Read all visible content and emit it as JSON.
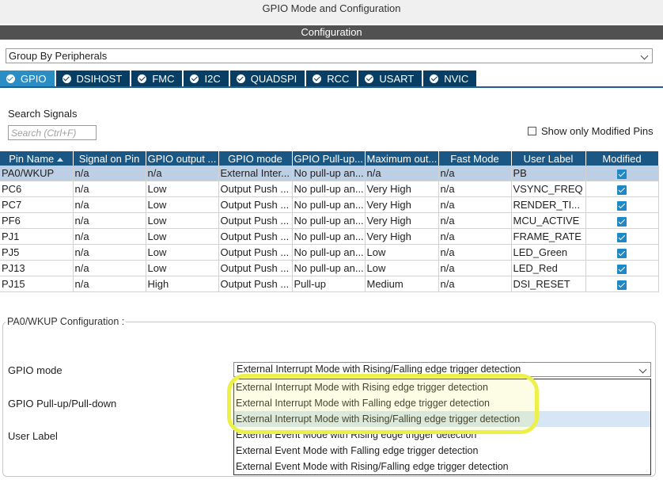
{
  "window": {
    "title": "GPIO Mode and Configuration"
  },
  "section": {
    "title": "Configuration"
  },
  "group_by": {
    "value": "Group By Peripherals"
  },
  "tabs": [
    {
      "label": "GPIO",
      "active": true
    },
    {
      "label": "DSIHOST"
    },
    {
      "label": "FMC"
    },
    {
      "label": "I2C"
    },
    {
      "label": "QUADSPI"
    },
    {
      "label": "RCC"
    },
    {
      "label": "USART"
    },
    {
      "label": "NVIC"
    }
  ],
  "search": {
    "label": "Search Signals",
    "placeholder": "Search (Ctrl+F)"
  },
  "show_modified": {
    "label": "Show only Modified Pins"
  },
  "table": {
    "headers": [
      "Pin Name",
      "Signal on Pin",
      "GPIO output ...",
      "GPIO mode",
      "GPIO Pull-up...",
      "Maximum out...",
      "Fast Mode",
      "User Label",
      "Modified"
    ],
    "rows": [
      {
        "pin": "PA0/WKUP",
        "signal": "n/a",
        "output": "n/a",
        "mode": "External Inter...",
        "pull": "No pull-up an...",
        "speed": "n/a",
        "fast": "n/a",
        "label": "PB",
        "selected": true
      },
      {
        "pin": "PC6",
        "signal": "n/a",
        "output": "Low",
        "mode": "Output Push ...",
        "pull": "No pull-up an...",
        "speed": "Very High",
        "fast": "n/a",
        "label": "VSYNC_FREQ"
      },
      {
        "pin": "PC7",
        "signal": "n/a",
        "output": "Low",
        "mode": "Output Push ...",
        "pull": "No pull-up an...",
        "speed": "Very High",
        "fast": "n/a",
        "label": "RENDER_TI..."
      },
      {
        "pin": "PF6",
        "signal": "n/a",
        "output": "Low",
        "mode": "Output Push ...",
        "pull": "No pull-up an...",
        "speed": "Very High",
        "fast": "n/a",
        "label": "MCU_ACTIVE"
      },
      {
        "pin": "PJ1",
        "signal": "n/a",
        "output": "Low",
        "mode": "Output Push ...",
        "pull": "No pull-up an...",
        "speed": "Very High",
        "fast": "n/a",
        "label": "FRAME_RATE"
      },
      {
        "pin": "PJ5",
        "signal": "n/a",
        "output": "Low",
        "mode": "Output Push ...",
        "pull": "No pull-up an...",
        "speed": "Low",
        "fast": "n/a",
        "label": "LED_Green"
      },
      {
        "pin": "PJ13",
        "signal": "n/a",
        "output": "Low",
        "mode": "Output Push ...",
        "pull": "No pull-up an...",
        "speed": "Low",
        "fast": "n/a",
        "label": "LED_Red"
      },
      {
        "pin": "PJ15",
        "signal": "n/a",
        "output": "High",
        "mode": "Output Push ...",
        "pull": "Pull-up",
        "speed": "Medium",
        "fast": "n/a",
        "label": "DSI_RESET"
      }
    ]
  },
  "config": {
    "title": "PA0/WKUP Configuration :",
    "labels": {
      "gpio_mode": "GPIO mode",
      "pull": "GPIO Pull-up/Pull-down",
      "user_label": "User Label"
    },
    "gpio_mode_value": "External Interrupt Mode with Rising/Falling edge trigger detection",
    "options": [
      "External Interrupt Mode with Rising edge trigger detection",
      "External Interrupt Mode with Falling edge trigger detection",
      "External Interrupt Mode with Rising/Falling edge trigger detection",
      "External Event Mode with Rising edge trigger detection",
      "External Event Mode with Falling edge trigger detection",
      "External Event Mode with Rising/Falling edge trigger detection"
    ]
  },
  "colors": {
    "section_bar": "#515151",
    "tab_bg": "#083e63",
    "tab_active": "#2a8dc4",
    "table_header": "#1a5785",
    "selected_row": "#bccfe4",
    "highlight": "#eef04a"
  }
}
